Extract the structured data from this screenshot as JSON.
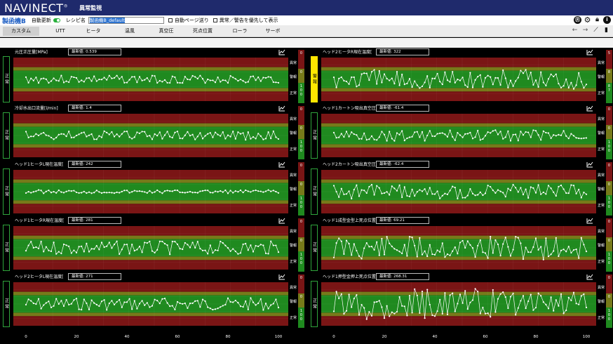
{
  "app": {
    "logo": "NAVINECT",
    "logo_mark": "®",
    "title": "異常監視"
  },
  "toolbar": {
    "machine_name": "製函機B",
    "auto_update_label": "自動更新",
    "auto_update_on": true,
    "recipe_label": "レシピ名",
    "recipe_value": "製函機B_default",
    "auto_page_label": "自動ページ送り",
    "priority_label": "異常／警告を優先して表示",
    "icons": [
      "rt-logo-icon",
      "gear-icon",
      "lock-icon",
      "info-icon"
    ]
  },
  "tabs": [
    {
      "label": "カスタム",
      "active": true
    },
    {
      "label": "UTT"
    },
    {
      "label": "ヒータ"
    },
    {
      "label": "温風"
    },
    {
      "label": "真空圧"
    },
    {
      "label": "死点位置"
    },
    {
      "label": "ローラ"
    },
    {
      "label": "サーボ"
    }
  ],
  "nav_icons": [
    "back-arrow-icon",
    "forward-arrow-icon",
    "line-chart-icon",
    "bar-chart-icon"
  ],
  "common": {
    "latest_prefix": "最新値:",
    "zone_labels": {
      "abnormal": "異常",
      "warning": "警報",
      "normal": "正常"
    },
    "status_normal": "正常",
    "status_warning": "警報",
    "x_ticks": [
      "0",
      "20",
      "40",
      "60",
      "80",
      "100"
    ],
    "colors": {
      "abnormal": "#7a1515",
      "warning": "#777a1a",
      "normal": "#1f8a1f",
      "warn_status": "#ffe600"
    }
  },
  "panels": [
    {
      "title": "元圧正圧量[MPa]",
      "latest": "0.539",
      "status": "正常",
      "counts": [
        "0",
        "0",
        "100"
      ],
      "amp": 0.18
    },
    {
      "title": "冷却水出口流量[l/min]",
      "latest": "1.4",
      "status": "正常",
      "counts": [
        "0",
        "0",
        "100"
      ],
      "amp": 0.2
    },
    {
      "title": "ヘッド1ヒータL現在温度[",
      "latest": "242",
      "status": "正常",
      "counts": [
        "0",
        "0",
        "100"
      ],
      "amp": 0.08
    },
    {
      "title": "ヘッド1ヒータR現在温度[",
      "latest": "281",
      "status": "正常",
      "counts": [
        "0",
        "0",
        "100"
      ],
      "amp": 0.3
    },
    {
      "title": "ヘッド2ヒータL現在温度[",
      "latest": "271",
      "status": "正常",
      "counts": [
        "0",
        "0",
        "100"
      ],
      "amp": 0.28
    },
    {
      "title": "ヘッド2ヒータR現在温度[",
      "latest": "322",
      "status": "警報",
      "counts": [
        "5",
        "8",
        "87"
      ],
      "amp": 0.45
    },
    {
      "title": "ヘッド1カートン吸出真空圧",
      "latest": "-61.4",
      "status": "正常",
      "counts": [
        "0",
        "0",
        "100"
      ],
      "amp": 0.25
    },
    {
      "title": "ヘッド2カートン吸出真空圧",
      "latest": "-62.4",
      "status": "正常",
      "counts": [
        "0",
        "0",
        "100"
      ],
      "amp": 0.32
    },
    {
      "title": "ヘッド1成型金型上死点位置",
      "latest": "69.21",
      "status": "正常",
      "counts": [
        "0",
        "0",
        "100"
      ],
      "amp": 0.55
    },
    {
      "title": "ヘッド1押型金押上死点位置",
      "latest": "268.31",
      "status": "正常",
      "counts": [
        "0",
        "0",
        "100"
      ],
      "amp": 0.7
    }
  ]
}
